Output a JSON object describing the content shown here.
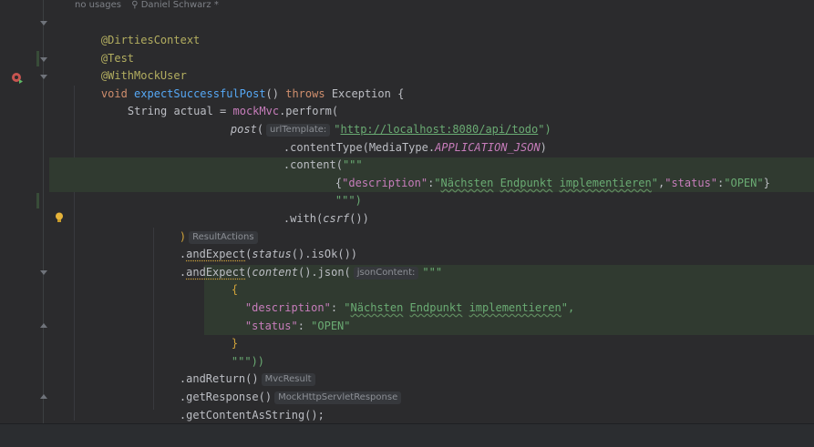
{
  "header_hints": {
    "usages": "no usages",
    "author": "Daniel Schwarz *"
  },
  "code": {
    "l1": "@DirtiesContext",
    "l2": "@Test",
    "l3": "@WithMockUser",
    "l4_void": "void",
    "l4_name": "expectSuccessfulPost",
    "l4_paren": "() ",
    "l4_throws": "throws",
    "l4_rest": " Exception {",
    "l5_a": "String actual = ",
    "l5_b": "mockMvc",
    "l5_c": ".perform(",
    "l6_post": "post",
    "l6_paren": "(",
    "l6_hint": "urlTemplate:",
    "l6_q1": "\"",
    "l6_url": "http://localhost:8080/api/todo",
    "l6_q2": "\")",
    "l7_a": ".contentType(MediaType.",
    "l7_b": "APPLICATION_JSON",
    "l7_c": ")",
    "l8_a": ".content(",
    "l8_b": "\"\"\"",
    "l9_a": "{",
    "l9_k1": "\"description\"",
    "l9_c1": ":",
    "l9_q1": "\"",
    "l9_v1a": "Nächsten",
    "l9_sp1": " ",
    "l9_v1b": "Endpunkt",
    "l9_sp2": " ",
    "l9_v1c": "implementieren",
    "l9_q2": "\"",
    "l9_c2": ",",
    "l9_k2": "\"status\"",
    "l9_c3": ":",
    "l9_v2": "\"OPEN\"",
    "l9_end": "}",
    "l10": "\"\"\")",
    "l11_a": ".with(",
    "l11_b": "csrf",
    "l11_c": "())",
    "l12_a": ")",
    "l12_hint": "ResultActions",
    "l13_a": ".",
    "l13_b": "andExpect",
    "l13_c": "(",
    "l13_d": "status",
    "l13_e": "().isOk())",
    "l14_a": ".",
    "l14_b": "andExpect",
    "l14_c": "(",
    "l14_d": "content",
    "l14_e": "().json(",
    "l14_hint": "jsonContent:",
    "l14_f": "\"\"\"",
    "l15": "{",
    "l16_k": "\"description\"",
    "l16_c": ": ",
    "l16_q1": "\"",
    "l16_v1": "Nächsten",
    "l16_sp1": " ",
    "l16_v2": "Endpunkt",
    "l16_sp2": " ",
    "l16_v3": "implementieren",
    "l16_q2": "\",",
    "l17_k": "\"status\"",
    "l17_c": ": ",
    "l17_v": "\"OPEN\"",
    "l18": "}",
    "l19": "\"\"\"))",
    "l20_a": ".andReturn()",
    "l20_hint": "MvcResult",
    "l21_a": ".getResponse()",
    "l21_hint": "MockHttpServletResponse",
    "l22_a": ".getContentAsString();"
  },
  "colors": {
    "background": "#2b2b2d",
    "annotation": "#b3ae60",
    "keyword": "#cf8e6d",
    "method": "#56a8f5",
    "string": "#6aab73",
    "field": "#c77dbb"
  },
  "icons": [
    "run-test-icon",
    "intention-bulb-icon",
    "fold-arrow-icon"
  ]
}
